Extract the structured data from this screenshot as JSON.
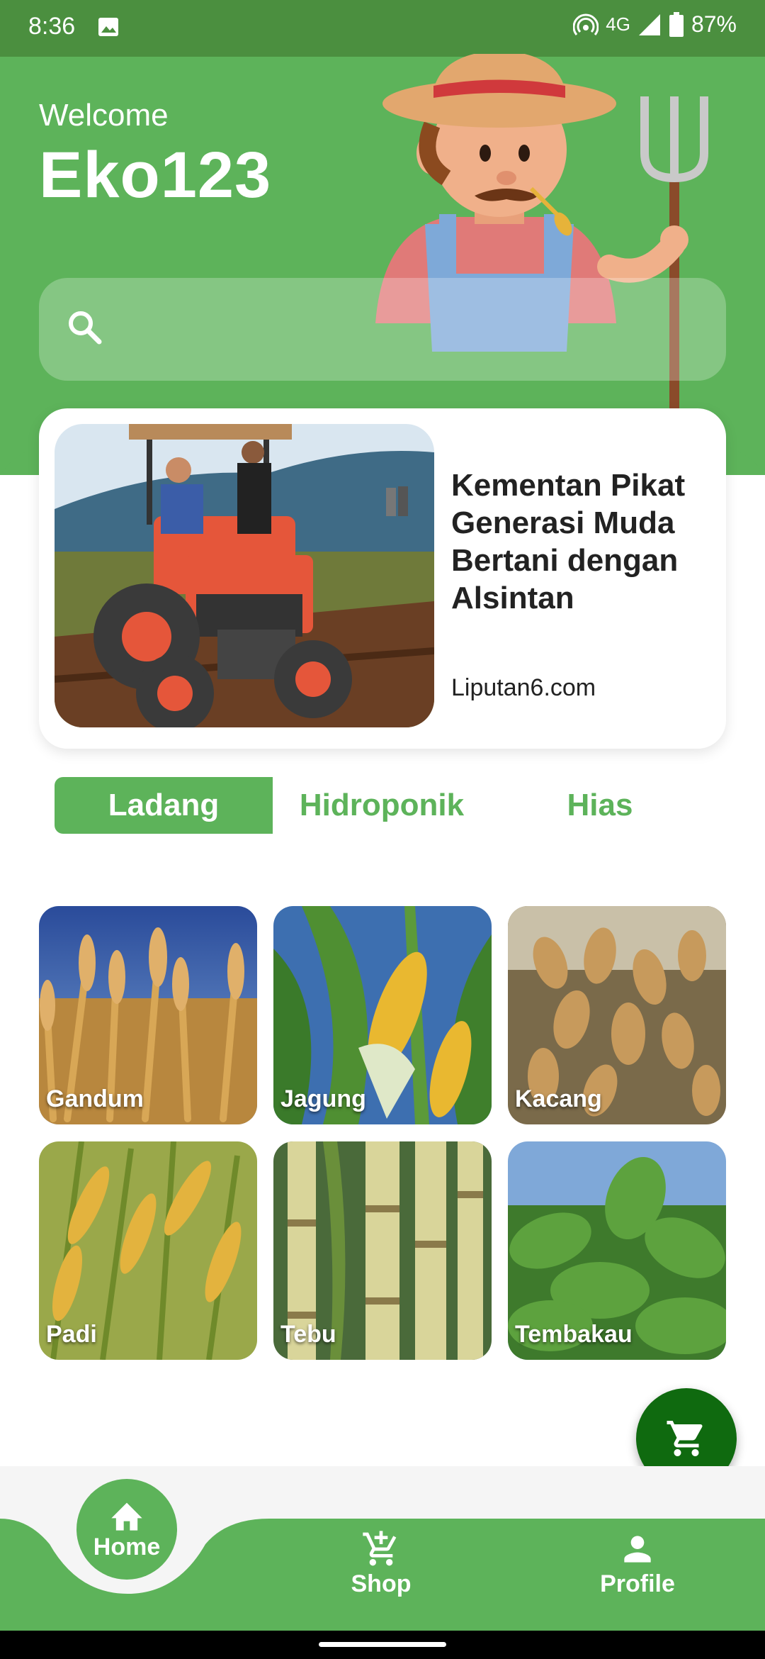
{
  "status_bar": {
    "time": "8:36",
    "network": "4G",
    "battery": "87%"
  },
  "header": {
    "welcome": "Welcome",
    "username": "Eko123"
  },
  "search": {
    "placeholder": "",
    "value": ""
  },
  "news": {
    "title": "Kementan Pikat Generasi Muda Bertani dengan Alsintan",
    "source": "Liputan6.com"
  },
  "tabs": [
    {
      "label": "Ladang",
      "active": true
    },
    {
      "label": "Hidroponik",
      "active": false
    },
    {
      "label": "Hias",
      "active": false
    }
  ],
  "crops": [
    {
      "label": "Gandum"
    },
    {
      "label": "Jagung"
    },
    {
      "label": "Kacang"
    },
    {
      "label": "Padi"
    },
    {
      "label": "Tebu"
    },
    {
      "label": "Tembakau"
    }
  ],
  "fab": {
    "icon": "cart-icon"
  },
  "bottom_nav": [
    {
      "label": "Home",
      "icon": "home-icon"
    },
    {
      "label": "Shop",
      "icon": "cart-add-icon"
    },
    {
      "label": "Profile",
      "icon": "person-icon"
    }
  ],
  "colors": {
    "primary": "#5db35a",
    "status_bar": "#4b8f3f",
    "fab": "#0f6a0f"
  }
}
